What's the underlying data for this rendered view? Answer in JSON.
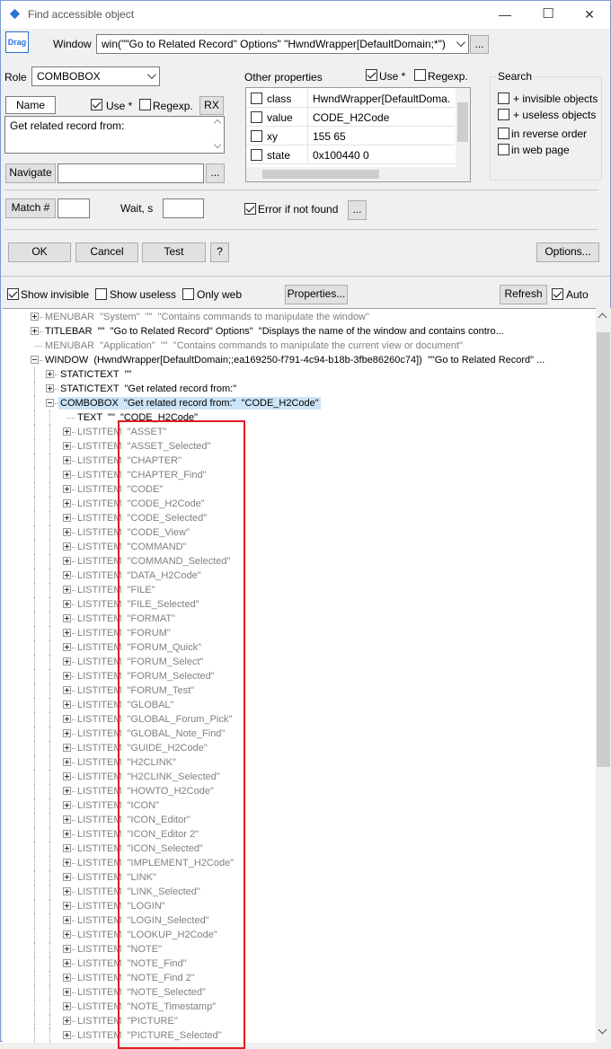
{
  "window": {
    "title": "Find accessible object",
    "minimize": "—",
    "maximize": "☐",
    "close": "✕"
  },
  "drag_label": "Drag",
  "window_field": {
    "label": "Window",
    "value": "win(\"\"Go to Related Record\" Options\" \"HwndWrapper[DefaultDomain;*\")",
    "more": "..."
  },
  "role": {
    "label": "Role",
    "value": "COMBOBOX"
  },
  "other_props": {
    "label": "Other properties",
    "use_label": "Use *",
    "use_checked": true,
    "regexp_label": "Regexp.",
    "regexp_checked": false,
    "rows": [
      {
        "name": "class",
        "value": "HwndWrapper[DefaultDoma..."
      },
      {
        "name": "value",
        "value": "CODE_H2Code"
      },
      {
        "name": "xy",
        "value": "155 65"
      },
      {
        "name": "state",
        "value": "0x100440 0"
      }
    ]
  },
  "search": {
    "label": "Search",
    "options": [
      {
        "label": "+ invisible objects",
        "checked": false
      },
      {
        "label": "+ useless objects",
        "checked": false
      },
      {
        "label": "in reverse order",
        "checked": false
      },
      {
        "label": "in web page",
        "checked": false
      }
    ]
  },
  "name": {
    "tab": "Name",
    "use_label": "Use *",
    "use_checked": true,
    "regexp_label": "Regexp.",
    "rx_button": "RX",
    "value": "Get related record from:"
  },
  "navigate": {
    "button": "Navigate",
    "more": "..."
  },
  "match": {
    "button": "Match #",
    "wait_label": "Wait, s"
  },
  "error_if_not_found": {
    "label": "Error if not found",
    "checked": true,
    "more": "..."
  },
  "buttons": {
    "ok": "OK",
    "cancel": "Cancel",
    "test": "Test",
    "help": "?",
    "options": "Options..."
  },
  "toolbar": {
    "show_invisible": "Show invisible",
    "show_invisible_checked": true,
    "show_useless": "Show useless",
    "only_web": "Only web",
    "properties": "Properties...",
    "refresh": "Refresh",
    "auto": "Auto",
    "auto_checked": true
  },
  "tree": [
    {
      "level": 1,
      "expander": "plus",
      "role": "MENUBAR",
      "text": "\"System\"  \"\"  \"Contains commands to manipulate the window\"",
      "gray": true
    },
    {
      "level": 1,
      "expander": "plus",
      "role": "TITLEBAR",
      "text": "\"\"  \"Go to Related Record\" Options\"  \"Displays the name of the window and contains contro...",
      "gray": false
    },
    {
      "level": 1,
      "expander": "none",
      "role": "MENUBAR",
      "text": "\"Application\"  \"\"  \"Contains commands to manipulate the current view or document\"",
      "gray": true
    },
    {
      "level": 1,
      "expander": "minus",
      "role": "WINDOW",
      "text": "(HwndWrapper[DefaultDomain;;ea169250-f791-4c94-b18b-3fbe86260c74])  \"\"Go to Related Record\" ...",
      "gray": false
    },
    {
      "level": 2,
      "expander": "plus",
      "role": "STATICTEXT",
      "text": "\"\"",
      "gray": false
    },
    {
      "level": 2,
      "expander": "plus",
      "role": "STATICTEXT",
      "text": "\"Get related record from:\"",
      "gray": false
    },
    {
      "level": 2,
      "expander": "minus",
      "role": "COMBOBOX",
      "text": "\"Get related record from:\"  \"CODE_H2Code\"",
      "gray": false,
      "selected": true
    },
    {
      "level": 3,
      "expander": "none",
      "role": "TEXT",
      "text": "\"\"  \"CODE_H2Code\"",
      "gray": false
    },
    {
      "level": 3,
      "expander": "plus",
      "role": "LISTITEM",
      "text": "\"ASSET\"",
      "gray": true
    },
    {
      "level": 3,
      "expander": "plus",
      "role": "LISTITEM",
      "text": "\"ASSET_Selected\"",
      "gray": true
    },
    {
      "level": 3,
      "expander": "plus",
      "role": "LISTITEM",
      "text": "\"CHAPTER\"",
      "gray": true
    },
    {
      "level": 3,
      "expander": "plus",
      "role": "LISTITEM",
      "text": "\"CHAPTER_Find\"",
      "gray": true
    },
    {
      "level": 3,
      "expander": "plus",
      "role": "LISTITEM",
      "text": "\"CODE\"",
      "gray": true
    },
    {
      "level": 3,
      "expander": "plus",
      "role": "LISTITEM",
      "text": "\"CODE_H2Code\"",
      "gray": true
    },
    {
      "level": 3,
      "expander": "plus",
      "role": "LISTITEM",
      "text": "\"CODE_Selected\"",
      "gray": true
    },
    {
      "level": 3,
      "expander": "plus",
      "role": "LISTITEM",
      "text": "\"CODE_View\"",
      "gray": true
    },
    {
      "level": 3,
      "expander": "plus",
      "role": "LISTITEM",
      "text": "\"COMMAND\"",
      "gray": true
    },
    {
      "level": 3,
      "expander": "plus",
      "role": "LISTITEM",
      "text": "\"COMMAND_Selected\"",
      "gray": true
    },
    {
      "level": 3,
      "expander": "plus",
      "role": "LISTITEM",
      "text": "\"DATA_H2Code\"",
      "gray": true
    },
    {
      "level": 3,
      "expander": "plus",
      "role": "LISTITEM",
      "text": "\"FILE\"",
      "gray": true
    },
    {
      "level": 3,
      "expander": "plus",
      "role": "LISTITEM",
      "text": "\"FILE_Selected\"",
      "gray": true
    },
    {
      "level": 3,
      "expander": "plus",
      "role": "LISTITEM",
      "text": "\"FORMAT\"",
      "gray": true
    },
    {
      "level": 3,
      "expander": "plus",
      "role": "LISTITEM",
      "text": "\"FORUM\"",
      "gray": true
    },
    {
      "level": 3,
      "expander": "plus",
      "role": "LISTITEM",
      "text": "\"FORUM_Quick\"",
      "gray": true
    },
    {
      "level": 3,
      "expander": "plus",
      "role": "LISTITEM",
      "text": "\"FORUM_Select\"",
      "gray": true
    },
    {
      "level": 3,
      "expander": "plus",
      "role": "LISTITEM",
      "text": "\"FORUM_Selected\"",
      "gray": true
    },
    {
      "level": 3,
      "expander": "plus",
      "role": "LISTITEM",
      "text": "\"FORUM_Test\"",
      "gray": true
    },
    {
      "level": 3,
      "expander": "plus",
      "role": "LISTITEM",
      "text": "\"GLOBAL\"",
      "gray": true
    },
    {
      "level": 3,
      "expander": "plus",
      "role": "LISTITEM",
      "text": "\"GLOBAL_Forum_Pick\"",
      "gray": true
    },
    {
      "level": 3,
      "expander": "plus",
      "role": "LISTITEM",
      "text": "\"GLOBAL_Note_Find\"",
      "gray": true
    },
    {
      "level": 3,
      "expander": "plus",
      "role": "LISTITEM",
      "text": "\"GUIDE_H2Code\"",
      "gray": true
    },
    {
      "level": 3,
      "expander": "plus",
      "role": "LISTITEM",
      "text": "\"H2CLINK\"",
      "gray": true
    },
    {
      "level": 3,
      "expander": "plus",
      "role": "LISTITEM",
      "text": "\"H2CLINK_Selected\"",
      "gray": true
    },
    {
      "level": 3,
      "expander": "plus",
      "role": "LISTITEM",
      "text": "\"HOWTO_H2Code\"",
      "gray": true
    },
    {
      "level": 3,
      "expander": "plus",
      "role": "LISTITEM",
      "text": "\"ICON\"",
      "gray": true
    },
    {
      "level": 3,
      "expander": "plus",
      "role": "LISTITEM",
      "text": "\"ICON_Editor\"",
      "gray": true
    },
    {
      "level": 3,
      "expander": "plus",
      "role": "LISTITEM",
      "text": "\"ICON_Editor 2\"",
      "gray": true
    },
    {
      "level": 3,
      "expander": "plus",
      "role": "LISTITEM",
      "text": "\"ICON_Selected\"",
      "gray": true
    },
    {
      "level": 3,
      "expander": "plus",
      "role": "LISTITEM",
      "text": "\"IMPLEMENT_H2Code\"",
      "gray": true
    },
    {
      "level": 3,
      "expander": "plus",
      "role": "LISTITEM",
      "text": "\"LINK\"",
      "gray": true
    },
    {
      "level": 3,
      "expander": "plus",
      "role": "LISTITEM",
      "text": "\"LINK_Selected\"",
      "gray": true
    },
    {
      "level": 3,
      "expander": "plus",
      "role": "LISTITEM",
      "text": "\"LOGIN\"",
      "gray": true
    },
    {
      "level": 3,
      "expander": "plus",
      "role": "LISTITEM",
      "text": "\"LOGIN_Selected\"",
      "gray": true
    },
    {
      "level": 3,
      "expander": "plus",
      "role": "LISTITEM",
      "text": "\"LOOKUP_H2Code\"",
      "gray": true
    },
    {
      "level": 3,
      "expander": "plus",
      "role": "LISTITEM",
      "text": "\"NOTE\"",
      "gray": true
    },
    {
      "level": 3,
      "expander": "plus",
      "role": "LISTITEM",
      "text": "\"NOTE_Find\"",
      "gray": true
    },
    {
      "level": 3,
      "expander": "plus",
      "role": "LISTITEM",
      "text": "\"NOTE_Find 2\"",
      "gray": true
    },
    {
      "level": 3,
      "expander": "plus",
      "role": "LISTITEM",
      "text": "\"NOTE_Selected\"",
      "gray": true
    },
    {
      "level": 3,
      "expander": "plus",
      "role": "LISTITEM",
      "text": "\"NOTE_Timestamp\"",
      "gray": true
    },
    {
      "level": 3,
      "expander": "plus",
      "role": "LISTITEM",
      "text": "\"PICTURE\"",
      "gray": true
    },
    {
      "level": 3,
      "expander": "plus",
      "role": "LISTITEM",
      "text": "\"PICTURE_Selected\"",
      "gray": true
    }
  ],
  "colors": {
    "highlight_box": "#e11b22",
    "selection": "#cce4f7",
    "drag_icon": "#2a6fd6"
  }
}
